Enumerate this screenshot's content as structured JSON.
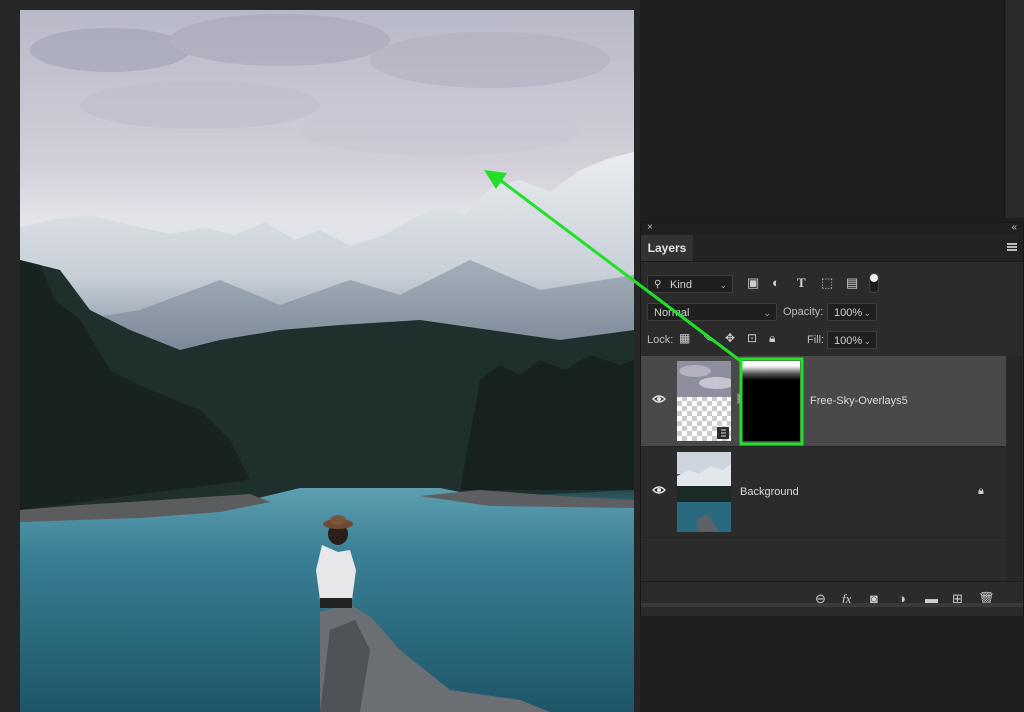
{
  "panel": {
    "close_glyph": "×",
    "collapse_glyph": "«",
    "tab_label": "Layers",
    "filter_kind": "Kind",
    "blend_mode": "Normal",
    "opacity_label": "Opacity:",
    "opacity_value": "100%",
    "lock_label": "Lock:",
    "fill_label": "Fill:",
    "fill_value": "100%"
  },
  "layers": [
    {
      "name": "Free-Sky-Overlays5",
      "visible": true,
      "has_mask": true,
      "selected": true,
      "locked": false
    },
    {
      "name": "Background",
      "visible": true,
      "has_mask": false,
      "selected": false,
      "locked": true
    }
  ],
  "icons": {
    "filter": [
      "image-filter-icon",
      "adjustment-filter-icon",
      "type-filter-icon",
      "shape-filter-icon",
      "smart-object-filter-icon",
      "filter-toggle-icon"
    ],
    "lock": [
      "lock-transparent-pixels-icon",
      "lock-image-pixels-icon",
      "lock-position-icon",
      "lock-artboard-icon",
      "lock-all-icon"
    ],
    "footer": [
      "link-layers-icon",
      "fx-icon",
      "add-mask-icon",
      "adjustment-layer-icon",
      "new-group-icon",
      "new-layer-icon",
      "delete-layer-icon"
    ]
  },
  "annotation": {
    "color": "#22e02a"
  }
}
